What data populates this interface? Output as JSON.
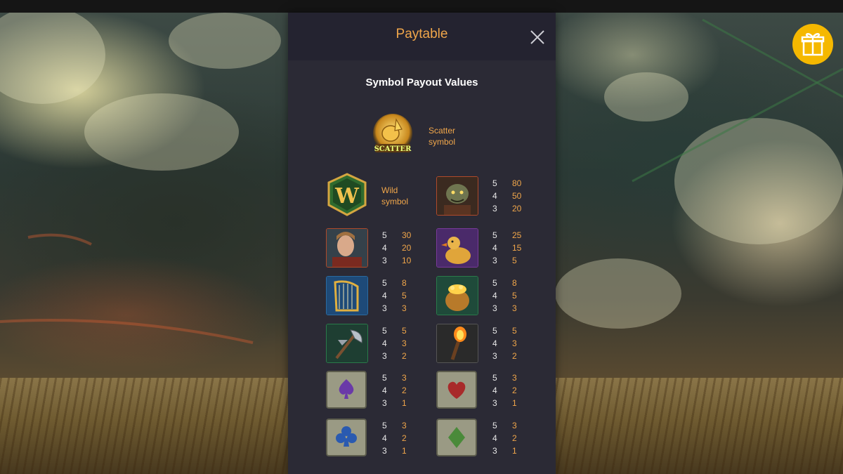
{
  "panel": {
    "title": "Paytable",
    "section_title": "Symbol Payout Values"
  },
  "scatter": {
    "label_line1": "Scatter",
    "label_line2": "symbol",
    "icon_text": "SCATTER"
  },
  "wild": {
    "label_line1": "Wild",
    "label_line2": "symbol",
    "icon_text": "W"
  },
  "paytable": [
    {
      "name": "troll",
      "pays": [
        {
          "count": "5",
          "amount": "80"
        },
        {
          "count": "4",
          "amount": "50"
        },
        {
          "count": "3",
          "amount": "20"
        }
      ]
    },
    {
      "name": "hero",
      "pays": [
        {
          "count": "5",
          "amount": "30"
        },
        {
          "count": "4",
          "amount": "20"
        },
        {
          "count": "3",
          "amount": "10"
        }
      ]
    },
    {
      "name": "goose",
      "pays": [
        {
          "count": "5",
          "amount": "25"
        },
        {
          "count": "4",
          "amount": "15"
        },
        {
          "count": "3",
          "amount": "5"
        }
      ]
    },
    {
      "name": "harp",
      "pays": [
        {
          "count": "5",
          "amount": "8"
        },
        {
          "count": "4",
          "amount": "5"
        },
        {
          "count": "3",
          "amount": "3"
        }
      ]
    },
    {
      "name": "gold-bag",
      "pays": [
        {
          "count": "5",
          "amount": "8"
        },
        {
          "count": "4",
          "amount": "5"
        },
        {
          "count": "3",
          "amount": "3"
        }
      ]
    },
    {
      "name": "axe",
      "pays": [
        {
          "count": "5",
          "amount": "5"
        },
        {
          "count": "4",
          "amount": "3"
        },
        {
          "count": "3",
          "amount": "2"
        }
      ]
    },
    {
      "name": "torch",
      "pays": [
        {
          "count": "5",
          "amount": "5"
        },
        {
          "count": "4",
          "amount": "3"
        },
        {
          "count": "3",
          "amount": "2"
        }
      ]
    },
    {
      "name": "spade",
      "pays": [
        {
          "count": "5",
          "amount": "3"
        },
        {
          "count": "4",
          "amount": "2"
        },
        {
          "count": "3",
          "amount": "1"
        }
      ]
    },
    {
      "name": "heart",
      "pays": [
        {
          "count": "5",
          "amount": "3"
        },
        {
          "count": "4",
          "amount": "2"
        },
        {
          "count": "3",
          "amount": "1"
        }
      ]
    },
    {
      "name": "club",
      "pays": [
        {
          "count": "5",
          "amount": "3"
        },
        {
          "count": "4",
          "amount": "2"
        },
        {
          "count": "3",
          "amount": "1"
        }
      ]
    },
    {
      "name": "diamond",
      "pays": [
        {
          "count": "5",
          "amount": "3"
        },
        {
          "count": "4",
          "amount": "2"
        },
        {
          "count": "3",
          "amount": "1"
        }
      ]
    }
  ],
  "icons": {
    "close": "close-icon",
    "gift": "gift-icon"
  },
  "colors": {
    "accent": "#f0a64a",
    "panel_bg": "#2b2a35",
    "header_bg": "#242330",
    "gift": "#f5b800"
  }
}
